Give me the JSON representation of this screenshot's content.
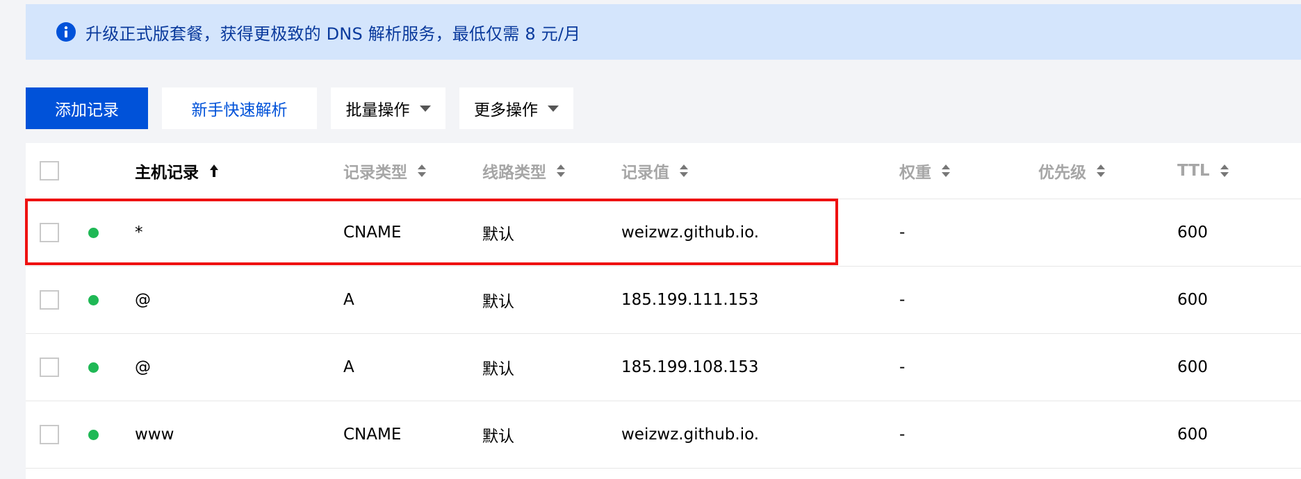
{
  "banner": {
    "icon": "info-icon",
    "text": "升级正式版套餐，获得更极致的 DNS 解析服务，最低仅需 8 元/月"
  },
  "toolbar": {
    "add_record": "添加记录",
    "quick_setup": "新手快速解析",
    "bulk_ops": "批量操作",
    "more_ops": "更多操作"
  },
  "table": {
    "columns": {
      "host": "主机记录",
      "type": "记录类型",
      "line": "线路类型",
      "value": "记录值",
      "weight": "权重",
      "priority": "优先级",
      "ttl": "TTL"
    },
    "sorted_column": "host",
    "rows": [
      {
        "host": "*",
        "type": "CNAME",
        "line": "默认",
        "value": "weizwz.github.io.",
        "weight": "-",
        "priority": "",
        "ttl": "600"
      },
      {
        "host": "@",
        "type": "A",
        "line": "默认",
        "value": "185.199.111.153",
        "weight": "-",
        "priority": "",
        "ttl": "600"
      },
      {
        "host": "@",
        "type": "A",
        "line": "默认",
        "value": "185.199.108.153",
        "weight": "-",
        "priority": "",
        "ttl": "600"
      },
      {
        "host": "www",
        "type": "CNAME",
        "line": "默认",
        "value": "weizwz.github.io.",
        "weight": "-",
        "priority": "",
        "ttl": "600"
      }
    ]
  },
  "colors": {
    "primary": "#0052d9",
    "banner_bg": "#d4e5fc",
    "status_enabled": "#1fb855",
    "highlight": "#ee1111"
  }
}
